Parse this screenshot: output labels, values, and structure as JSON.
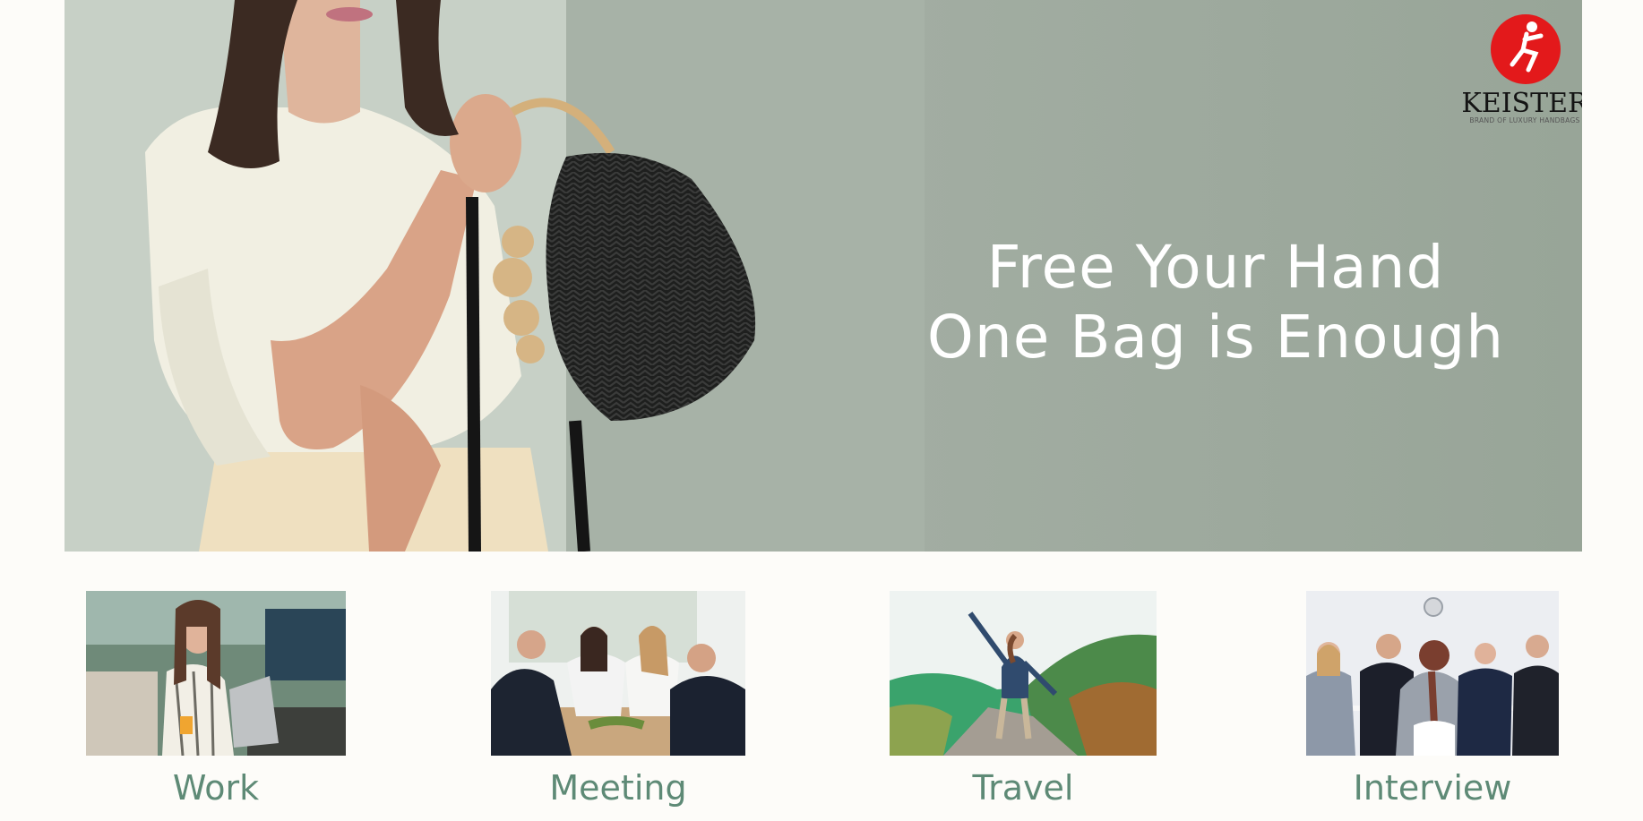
{
  "banner": {
    "headline_line1": "Free Your Hand",
    "headline_line2": "One Bag is Enough"
  },
  "brand": {
    "name": "KEISTER",
    "tagline": "BRAND OF LUXURY HANDBAGS",
    "logo_color": "#e3191b"
  },
  "categories": [
    {
      "label": "Work"
    },
    {
      "label": "Meeting"
    },
    {
      "label": "Travel"
    },
    {
      "label": "Interview"
    }
  ],
  "colors": {
    "banner_background": "#98a598",
    "caption_text": "#5e8a76",
    "headline_text": "#ffffff",
    "page_background": "#fdfcf9"
  }
}
